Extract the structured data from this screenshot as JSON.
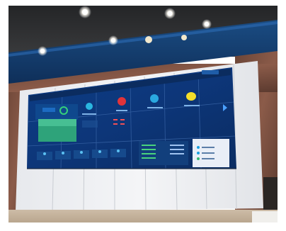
{
  "scene": {
    "description": "",
    "screen": {
      "header_left": "",
      "header_center": "",
      "header_right": "",
      "tiles": [
        {
          "label": "",
          "color": "#2ab6e0"
        },
        {
          "label": "",
          "color": "#e2333a"
        },
        {
          "label": "",
          "color": "#2aa8e0"
        },
        {
          "label": "",
          "color": "#f5df2a"
        }
      ],
      "bottom_left_title": "",
      "bottom_right_title": ""
    }
  }
}
